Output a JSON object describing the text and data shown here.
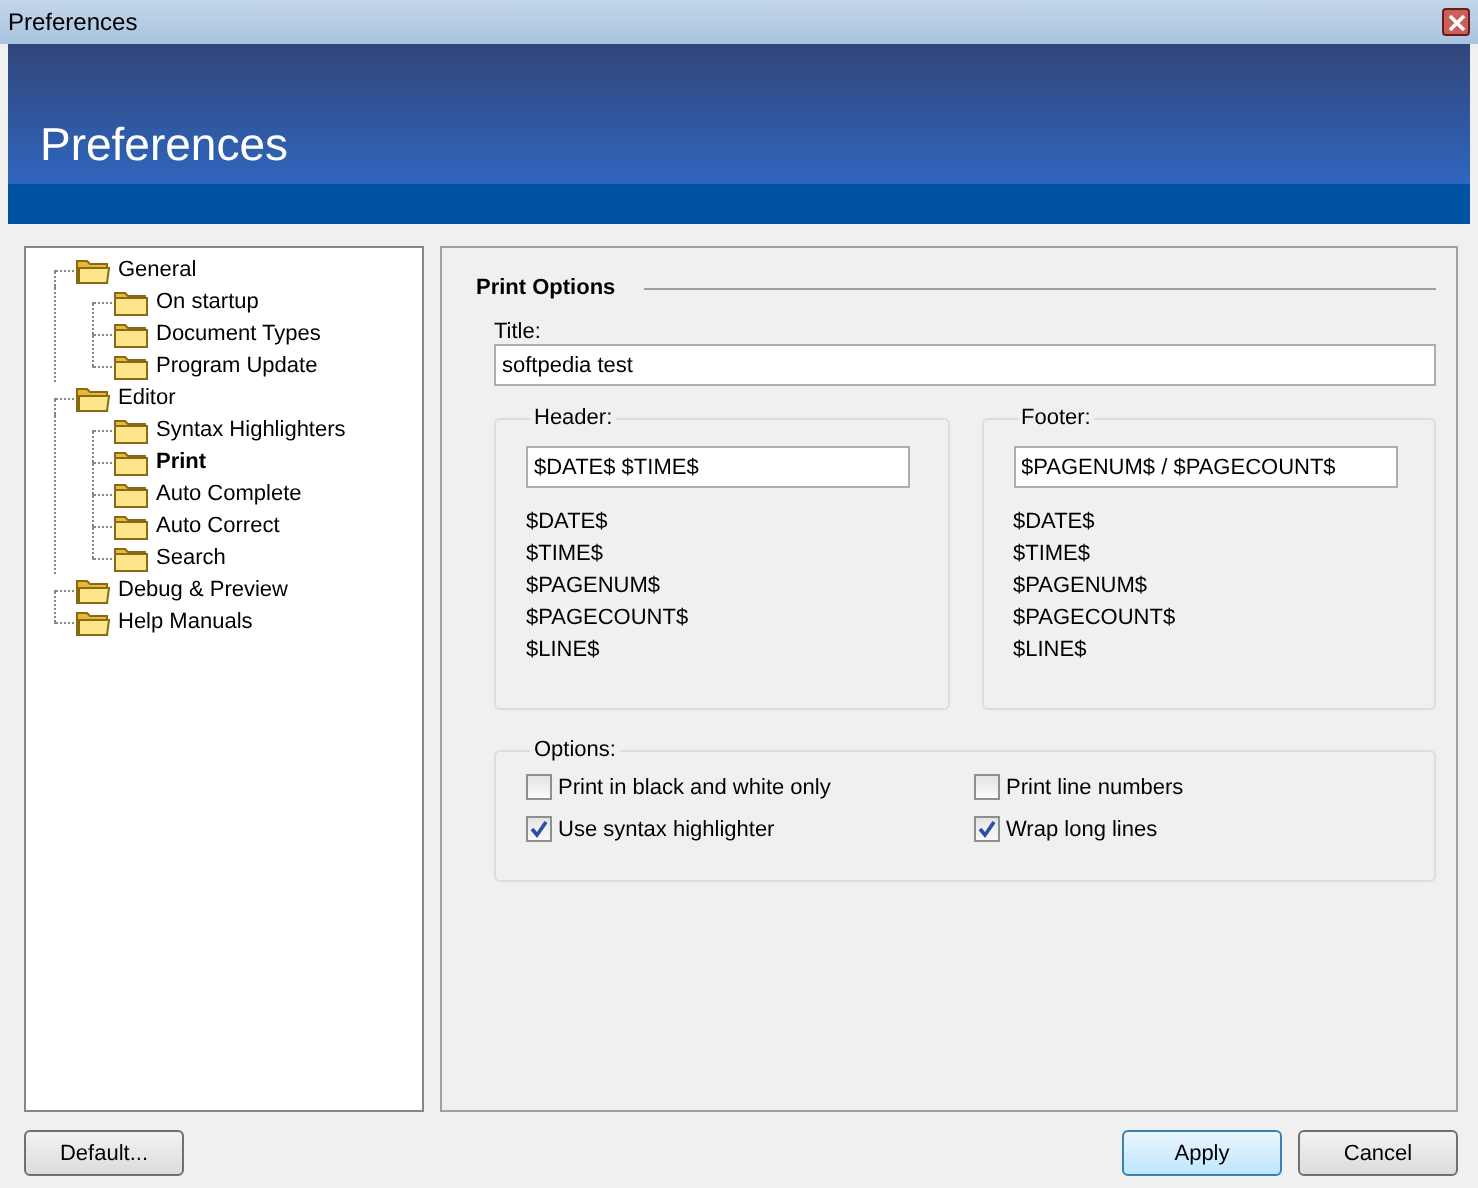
{
  "window": {
    "title": "Preferences"
  },
  "banner": {
    "title": "Preferences"
  },
  "tree": [
    {
      "label": "General",
      "selected": false,
      "children": [
        {
          "label": "On startup",
          "selected": false
        },
        {
          "label": "Document Types",
          "selected": false
        },
        {
          "label": "Program Update",
          "selected": false
        }
      ]
    },
    {
      "label": "Editor",
      "selected": false,
      "children": [
        {
          "label": "Syntax Highlighters",
          "selected": false
        },
        {
          "label": "Print",
          "selected": true
        },
        {
          "label": "Auto Complete",
          "selected": false
        },
        {
          "label": "Auto Correct",
          "selected": false
        },
        {
          "label": "Search",
          "selected": false
        }
      ]
    },
    {
      "label": "Debug & Preview",
      "selected": false
    },
    {
      "label": "Help Manuals",
      "selected": false
    }
  ],
  "print_options": {
    "heading": "Print Options",
    "title_label": "Title:",
    "title_value": "softpedia test",
    "header": {
      "legend": "Header:",
      "value": "$DATE$ $TIME$",
      "variables": [
        "$DATE$",
        "$TIME$",
        "$PAGENUM$",
        "$PAGECOUNT$",
        "$LINE$"
      ]
    },
    "footer": {
      "legend": "Footer:",
      "value": "$PAGENUM$ / $PAGECOUNT$",
      "variables": [
        "$DATE$",
        "$TIME$",
        "$PAGENUM$",
        "$PAGECOUNT$",
        "$LINE$"
      ]
    },
    "options": {
      "legend": "Options:",
      "items": [
        {
          "label": "Print in black and white only",
          "checked": false
        },
        {
          "label": "Print line numbers",
          "checked": false
        },
        {
          "label": "Use syntax highlighter",
          "checked": true
        },
        {
          "label": "Wrap long lines",
          "checked": true
        }
      ]
    }
  },
  "buttons": {
    "default": "Default...",
    "apply": "Apply",
    "cancel": "Cancel"
  }
}
